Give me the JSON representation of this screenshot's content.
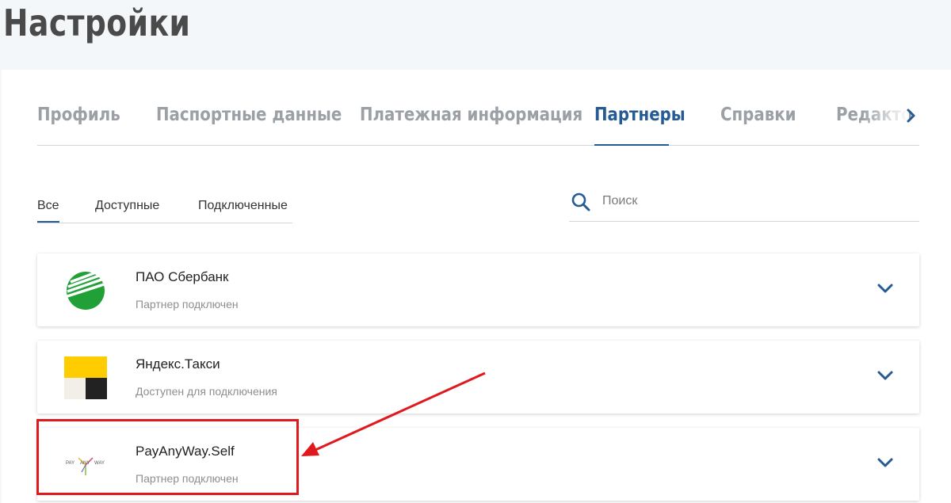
{
  "page": {
    "title": "Настройки"
  },
  "tabs": [
    {
      "label": "Профиль",
      "active": false
    },
    {
      "label": "Паспортные данные",
      "active": false
    },
    {
      "label": "Платежная информация",
      "active": false
    },
    {
      "label": "Партнеры",
      "active": true
    },
    {
      "label": "Справки",
      "active": false
    },
    {
      "label": "Редакто",
      "active": false
    }
  ],
  "filters": [
    {
      "label": "Все",
      "active": true
    },
    {
      "label": "Доступные",
      "active": false
    },
    {
      "label": "Подключенные",
      "active": false
    }
  ],
  "search": {
    "placeholder": "Поиск",
    "value": ""
  },
  "partners": [
    {
      "name": "ПАО Сбербанк",
      "status": "Партнер подключен",
      "logo": "sberbank-logo"
    },
    {
      "name": "Яндекс.Такси",
      "status": "Доступен для подключения",
      "logo": "yandex-taxi-logo"
    },
    {
      "name": "PayAnyWay.Self",
      "status": "Партнер подключен",
      "logo": "payanyway-logo",
      "logo_text": [
        "PAY",
        "ANY",
        "WAY"
      ]
    }
  ],
  "annotation": {
    "color": "#e0191f",
    "target": "PayAnyWay.Self"
  },
  "colors": {
    "accent": "#245b94",
    "inactive_tab": "#9aa0a6",
    "sber_green": "#21a038",
    "yandex_yellow": "#ffcc00"
  }
}
